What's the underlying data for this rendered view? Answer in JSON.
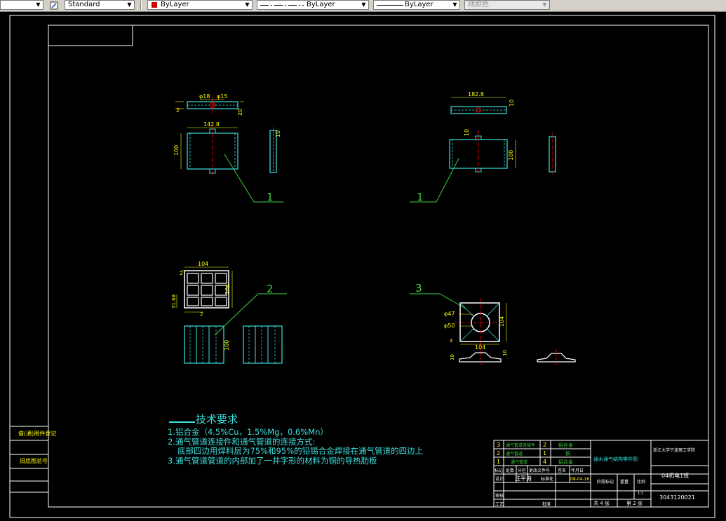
{
  "toolbar": {
    "text_style": "Standard",
    "layer": "ByLayer",
    "linetype": "ByLayer",
    "lineweight": "ByLayer",
    "plot_style": "随颜色",
    "colors": {
      "layer_swatch": "#cc0000"
    }
  },
  "drawing": {
    "views": {
      "top_left": {
        "dim_d18": "φ18",
        "dim_d15": "φ15",
        "dim_2": "2",
        "dim_20": "20",
        "dim_width": "142.8",
        "dim_height": "100",
        "dim_side": "10",
        "label": "1"
      },
      "top_right": {
        "dim_width": "182.8",
        "dim_10a": "10",
        "dim_10b": "10",
        "dim_height": "100",
        "label": "1"
      },
      "grid_view": {
        "dim_width": "104",
        "dim_height": "104",
        "dim_thick": "2",
        "dim_cell": "31.68",
        "dim_pitch": "2",
        "dim_side": "100",
        "label": "2"
      },
      "flange_view": {
        "dim_d47": "φ47",
        "dim_d50": "φ50",
        "dim_4": "4",
        "dim_width": "104",
        "dim_height": "104",
        "dim_10": "10",
        "dim_side10": "10",
        "label": "3"
      }
    },
    "tech_requirements": {
      "title": "技术要求",
      "items": [
        "1.铝合金（4.5%Cu，1.5%Mg，0.6%Mn）",
        "2.通气管道连接件和通气管道的连接方式:",
        "底部四边用焊料层为75%和95%的铅锡合金焊接在通气管道的四边上",
        "3.通气管道管道的内部加了一井字形的材料为铜的导热肋板"
      ]
    },
    "left_strip": {
      "label1": "借(通)用件登记",
      "label2": "旧底图总号"
    },
    "title_block": {
      "parts": [
        {
          "no": "3",
          "name": "通气管道连接件",
          "qty": "2",
          "material": "铝合金"
        },
        {
          "no": "2",
          "name": "通气管道",
          "qty": "1",
          "material": "铜"
        },
        {
          "no": "1",
          "name": "通气管道",
          "qty": "4",
          "material": "铝合金"
        }
      ],
      "headers": [
        "标记",
        "处数",
        "分区",
        "更改文件号",
        "签名",
        "年月日"
      ],
      "design_label": "设计",
      "designer": "汪平海",
      "std_label": "标准化",
      "date": "08-04-16",
      "check_label": "审核",
      "process_label": "工艺",
      "approve_label": "批准",
      "stage_label": "阶段标记",
      "weight_label": "重量",
      "scale_label": "比例",
      "scale": "1:1",
      "total_label": "共 4 张",
      "sheet_label": "第 2 张",
      "drawing_title": "通水通气结构零件图",
      "school": "浙江大学宁波理工学院",
      "class": "04机电1班",
      "student_id": "3043120021"
    },
    "colors": {
      "cyan": "#3ee0e0",
      "yellow": "#ffff00",
      "green": "#3ecf3e",
      "red": "#ff0000",
      "white": "#ffffff"
    }
  }
}
